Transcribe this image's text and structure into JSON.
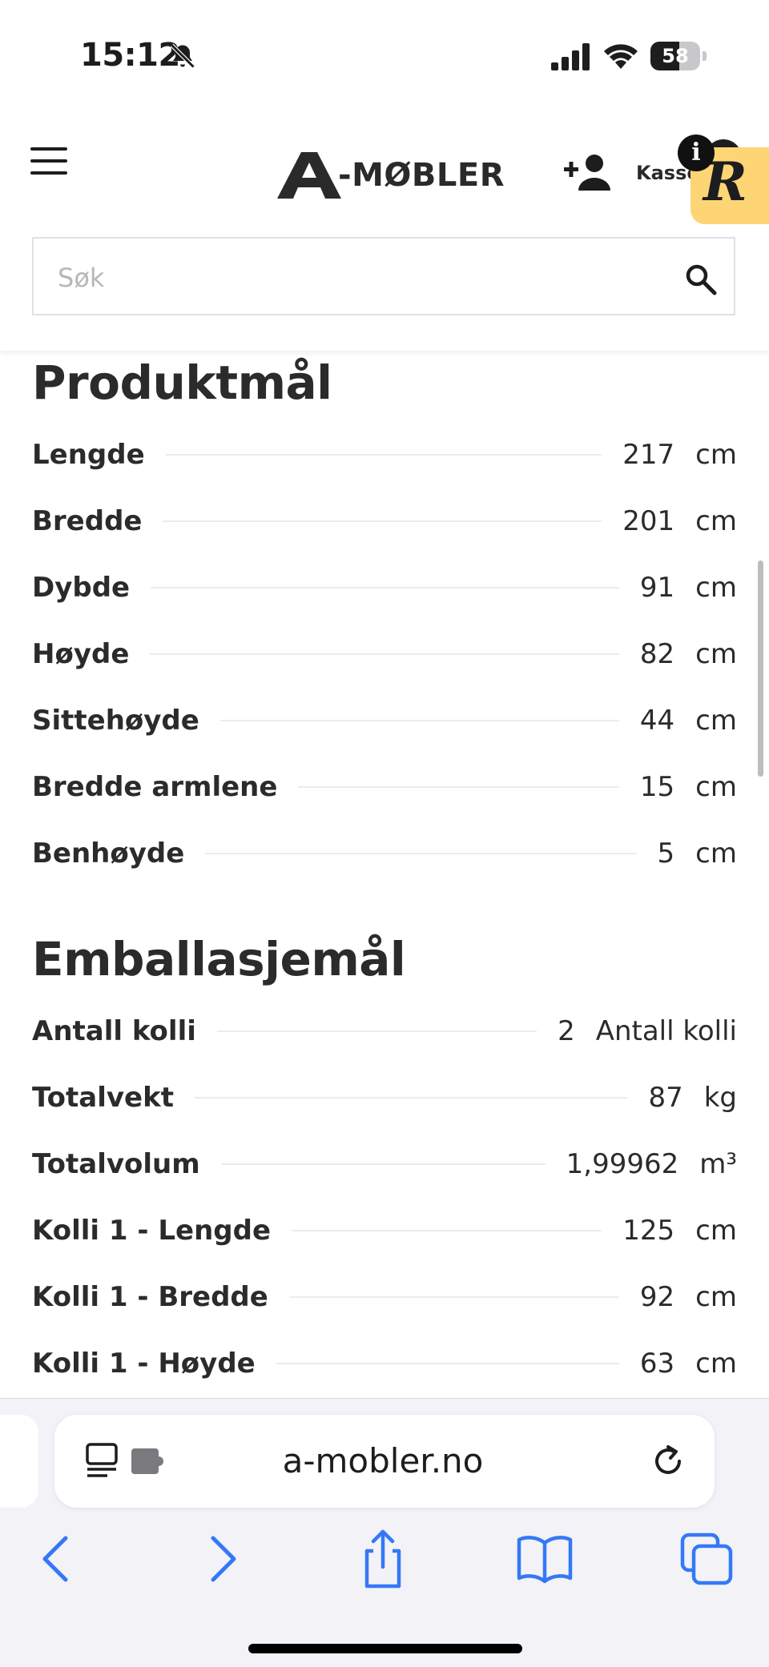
{
  "status_bar": {
    "time": "15:12",
    "battery_level": "58",
    "battery_fraction": 0.58
  },
  "header": {
    "logo_text": "-MØBLER",
    "cart_label": "Kasse",
    "info_badge": "i",
    "r_badge": "R",
    "search_placeholder": "Søk"
  },
  "colors": {
    "text": "#2b2b2b",
    "badge_yellow": "#fdd575",
    "safari_blue": "#3478f6"
  },
  "sections": [
    {
      "title": "Produktmål",
      "rows": [
        {
          "label": "Lengde",
          "value": "217",
          "unit": "cm"
        },
        {
          "label": "Bredde",
          "value": "201",
          "unit": "cm"
        },
        {
          "label": "Dybde",
          "value": "91",
          "unit": "cm"
        },
        {
          "label": "Høyde",
          "value": "82",
          "unit": "cm"
        },
        {
          "label": "Sittehøyde",
          "value": "44",
          "unit": "cm"
        },
        {
          "label": "Bredde armlene",
          "value": "15",
          "unit": "cm"
        },
        {
          "label": "Benhøyde",
          "value": "5",
          "unit": "cm"
        }
      ]
    },
    {
      "title": "Emballasjemål",
      "rows": [
        {
          "label": "Antall kolli",
          "value": "2",
          "unit": "Antall kolli"
        },
        {
          "label": "Totalvekt",
          "value": "87",
          "unit": "kg"
        },
        {
          "label": "Totalvolum",
          "value": "1,99962",
          "unit": "m³"
        },
        {
          "label": "Kolli 1 - Lengde",
          "value": "125",
          "unit": "cm"
        },
        {
          "label": "Kolli 1 - Bredde",
          "value": "92",
          "unit": "cm"
        },
        {
          "label": "Kolli 1 - Høyde",
          "value": "63",
          "unit": "cm"
        }
      ]
    }
  ],
  "browser": {
    "url": "a-mobler.no",
    "icons": [
      "reader-icon",
      "extension-icon",
      "reload-icon",
      "back-icon",
      "forward-icon",
      "share-icon",
      "bookmarks-icon",
      "tabs-icon"
    ]
  }
}
